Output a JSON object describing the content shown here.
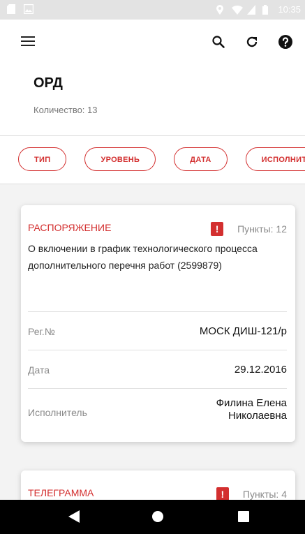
{
  "status_bar": {
    "time": "10:35",
    "icons": [
      "sim-card-icon",
      "image-icon",
      "location-icon",
      "wifi-icon",
      "signal-icon",
      "battery-icon"
    ]
  },
  "appbar": {
    "icons": [
      "menu-icon",
      "search-icon",
      "refresh-icon",
      "help-icon"
    ]
  },
  "header": {
    "title": "ОРД",
    "count_text": "Количество: 13"
  },
  "filters": {
    "chips": [
      "ТИП",
      "УРОВЕНЬ",
      "ДАТА",
      "ИСПОЛНИТЕЛЬ"
    ]
  },
  "cards": [
    {
      "type": "РАСПОРЯЖЕНИЕ",
      "points": "Пункты: 12",
      "description": "О включении в график технологического процесса дополнительного перечня работ (2599879)",
      "reg_label": "Рег.№",
      "reg_value": "МОСК ДИШ-121/р",
      "date_label": "Дата",
      "date_value": "29.12.2016",
      "executor_label": "Исполнитель",
      "executor_value_line1": "Филина Елена",
      "executor_value_line2": "Николаевна"
    },
    {
      "type": "ТЕЛЕГРАММА",
      "points": "Пункты: 4"
    }
  ],
  "colors": {
    "accent": "#d32f2f",
    "status_bar": "#e3e3e3",
    "content_bg": "#f3f3f3",
    "nav_bar": "#000000"
  }
}
